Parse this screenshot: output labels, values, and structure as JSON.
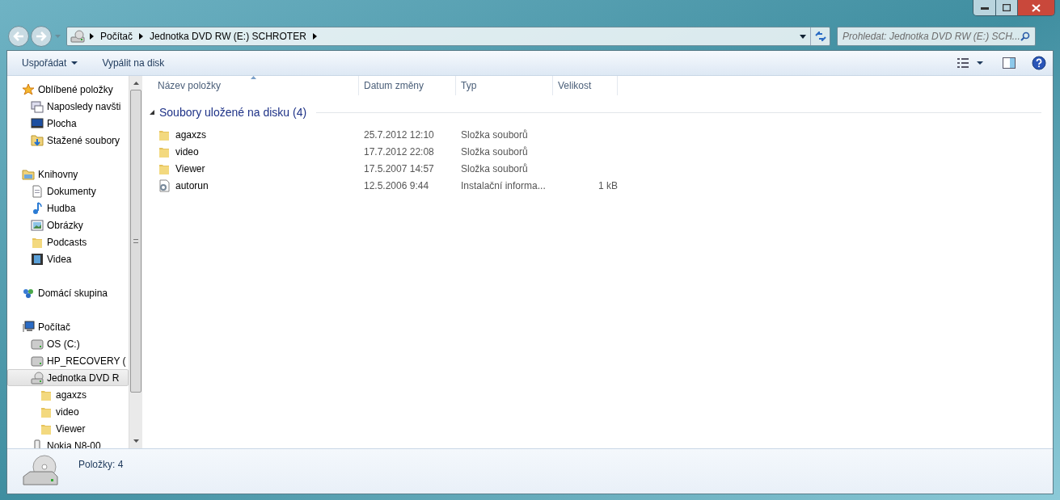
{
  "address": {
    "crumbs": [
      "Počítač",
      "Jednotka DVD RW (E:) SCHROTER"
    ]
  },
  "search": {
    "placeholder": "Prohledat: Jednotka DVD RW (E:) SCH..."
  },
  "toolbar": {
    "buttons": [
      {
        "label": "Uspořádat",
        "dropdown": true
      },
      {
        "label": "Vypálit na disk",
        "dropdown": false
      }
    ]
  },
  "sidebar": {
    "items": [
      {
        "label": "Oblíbené položky",
        "kind": "star",
        "selected": false,
        "children": [
          {
            "label": "Naposledy navšti",
            "kind": "recent",
            "selected": false
          },
          {
            "label": "Plocha",
            "kind": "desktop",
            "selected": false
          },
          {
            "label": "Stažené soubory",
            "kind": "downloads",
            "selected": false
          }
        ]
      },
      {
        "label": "Knihovny",
        "kind": "library",
        "selected": false,
        "children": [
          {
            "label": "Dokumenty",
            "kind": "document",
            "selected": false
          },
          {
            "label": "Hudba",
            "kind": "music",
            "selected": false
          },
          {
            "label": "Obrázky",
            "kind": "pictures",
            "selected": false
          },
          {
            "label": "Podcasts",
            "kind": "folder",
            "selected": false
          },
          {
            "label": "Videa",
            "kind": "video",
            "selected": false
          }
        ]
      },
      {
        "label": "Domácí skupina",
        "kind": "homegroup",
        "selected": false
      },
      {
        "label": "Počítač",
        "kind": "computer",
        "selected": false,
        "children": [
          {
            "label": "OS (C:)",
            "kind": "drive",
            "selected": false
          },
          {
            "label": "HP_RECOVERY (",
            "kind": "drive",
            "selected": false
          },
          {
            "label": "Jednotka DVD R",
            "kind": "dvd",
            "selected": true,
            "children": [
              {
                "label": "agaxzs",
                "kind": "folder",
                "selected": false
              },
              {
                "label": "video",
                "kind": "folder",
                "selected": false
              },
              {
                "label": "Viewer",
                "kind": "folder",
                "selected": false
              }
            ]
          },
          {
            "label": "Nokia N8-00",
            "kind": "phone",
            "selected": false
          }
        ]
      }
    ]
  },
  "table": {
    "columns": [
      "Název položky",
      "Datum změny",
      "Typ",
      "Velikost"
    ],
    "group": {
      "label": "Soubory uložené na disku (4)",
      "expanded": true
    },
    "rows": [
      {
        "name": "agaxzs",
        "kind": "folder",
        "date": "25.7.2012 12:10",
        "type": "Složka souborů"
      },
      {
        "name": "video",
        "kind": "folder",
        "date": "17.7.2012 22:08",
        "type": "Složka souborů"
      },
      {
        "name": "Viewer",
        "kind": "folder",
        "date": "17.5.2007 14:57",
        "type": "Složka souborů"
      },
      {
        "name": "autorun",
        "kind": "settings",
        "date": "12.5.2006 9:44",
        "type": "Instalační informa...",
        "size": "1 kB"
      }
    ]
  },
  "status_bar": {
    "text": "Položky: 4"
  }
}
